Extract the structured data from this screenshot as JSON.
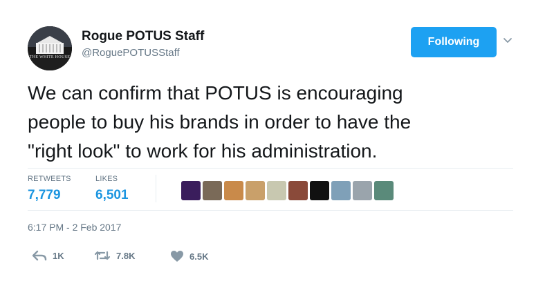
{
  "user": {
    "name": "Rogue POTUS Staff",
    "handle": "@RoguePOTUSStaff",
    "avatar_caption": "THE WHITE HOUSE"
  },
  "follow_button": {
    "label": "Following"
  },
  "tweet": {
    "line1": "We can confirm that POTUS is encouraging",
    "line2": "people to buy his brands in order to have the",
    "line3": "\"right look\" to work for his administration."
  },
  "stats": {
    "retweets_label": "RETWEETS",
    "retweets_value": "7,779",
    "likes_label": "LIKES",
    "likes_value": "6,501"
  },
  "likers": [
    {
      "name": "liker-avatar-1",
      "color": "#3a1d5c"
    },
    {
      "name": "liker-avatar-2",
      "color": "#7a6a58"
    },
    {
      "name": "liker-avatar-3",
      "color": "#c98a4a"
    },
    {
      "name": "liker-avatar-4",
      "color": "#c9a06a"
    },
    {
      "name": "liker-avatar-5",
      "color": "#c8c8b0"
    },
    {
      "name": "liker-avatar-6",
      "color": "#8a4a3a"
    },
    {
      "name": "liker-avatar-7",
      "color": "#111111"
    },
    {
      "name": "liker-avatar-8",
      "color": "#7fa0b8"
    },
    {
      "name": "liker-avatar-9",
      "color": "#9aa4ac"
    },
    {
      "name": "liker-avatar-10",
      "color": "#5a8a7a"
    }
  ],
  "timestamp": "6:17 PM - 2 Feb 2017",
  "actions": {
    "reply_count": "1K",
    "retweet_count": "7.8K",
    "like_count": "6.5K"
  },
  "colors": {
    "accent": "#1da1f2",
    "stat_value": "#1b95e0",
    "muted": "#657786",
    "text": "#14171a",
    "divider": "#e6ecf0"
  },
  "icons": [
    "chevron-down-icon",
    "reply-icon",
    "retweet-icon",
    "heart-icon",
    "white-house-icon"
  ]
}
